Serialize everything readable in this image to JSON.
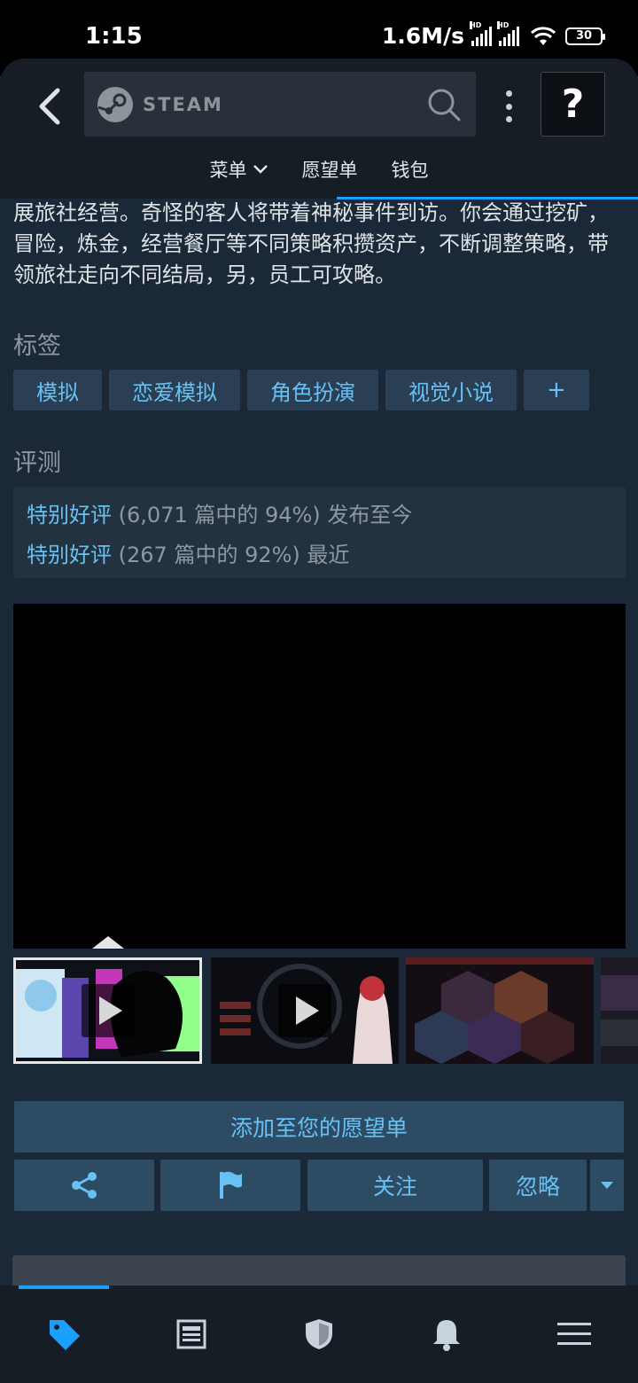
{
  "status_bar": {
    "time": "1:15",
    "network_speed": "1.6M/s",
    "signal_label": "HD",
    "battery": "30"
  },
  "header": {
    "search_brand": "STEAM",
    "help_label": "?",
    "subnav": [
      {
        "label": "菜单"
      },
      {
        "label": "愿望单"
      },
      {
        "label": "钱包"
      }
    ]
  },
  "game": {
    "description": "大千黑暗侵扰。你将招募无神、魔族、精灵等，共建美好员工开展旅社经营。奇怪的客人将带着神秘事件到访。你会通过挖矿，冒险，炼金，经营餐厅等不同策略积攒资产，不断调整策略，带领旅社走向不同结局，另，员工可攻略。",
    "tags_title": "标签",
    "tags": [
      "模拟",
      "恋爱模拟",
      "角色扮演",
      "视觉小说",
      "+"
    ],
    "reviews_title": "评测",
    "reviews": [
      {
        "rating": "特别好评",
        "detail": "(6,071 篇中的 94%)",
        "scope": "发布至今"
      },
      {
        "rating": "特别好评",
        "detail": "(267 篇中的 92%)",
        "scope": "最近"
      }
    ]
  },
  "actions": {
    "wishlist": "添加至您的愿望单",
    "follow": "关注",
    "ignore": "忽略"
  },
  "colors": {
    "background": "#1b2838",
    "accent_blue": "#66c0f4",
    "button_bg": "#2d4b63",
    "tag_bg": "#2a3f54",
    "header_bg": "#171d25"
  }
}
